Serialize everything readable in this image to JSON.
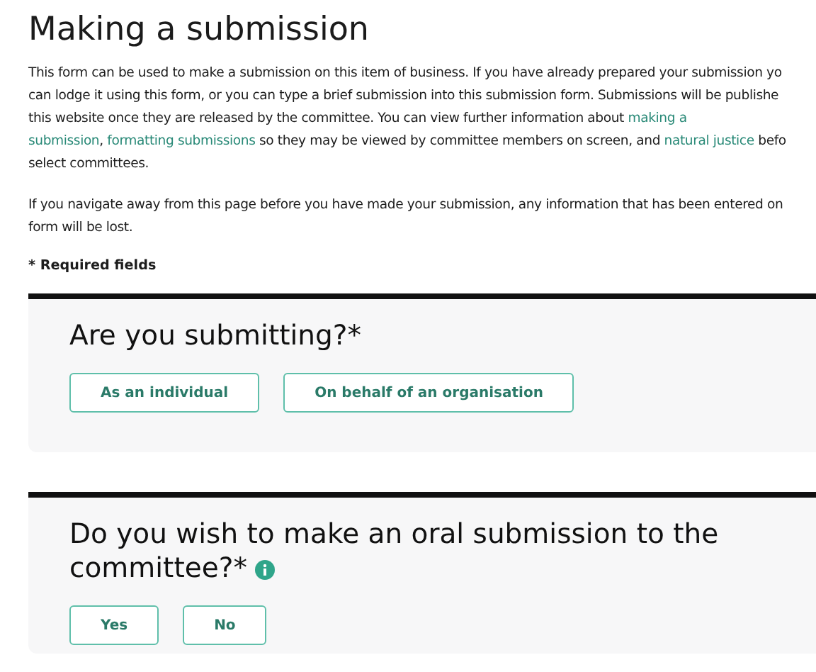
{
  "title": "Making a submission",
  "paragraphs": [
    [
      [
        {
          "text": "This form can be used to make a submission on this item of business. If you have already prepared your submission yo",
          "link": false
        }
      ],
      [
        {
          "text": "can lodge it using this form, or you can type a brief submission into this submission form. Submissions will be publishe",
          "link": false
        }
      ],
      [
        {
          "text": "this website once they are released by the committee. You can view further information about ",
          "link": false
        },
        {
          "text": "making a",
          "link": true
        }
      ],
      [
        {
          "text": "submission",
          "link": true
        },
        {
          "text": ", ",
          "link": false
        },
        {
          "text": "formatting submissions",
          "link": true
        },
        {
          "text": " so they may be viewed by committee members on screen, and ",
          "link": false
        },
        {
          "text": "natural justice",
          "link": true
        },
        {
          "text": " befo",
          "link": false
        }
      ],
      [
        {
          "text": "select committees.",
          "link": false
        }
      ]
    ],
    [
      [
        {
          "text": "If you navigate away from this page before you have made your submission, any information that has been entered on",
          "link": false
        }
      ],
      [
        {
          "text": "form will be lost.",
          "link": false
        }
      ]
    ]
  ],
  "required_note": "* Required fields",
  "questions": [
    {
      "question": "Are you submitting?*",
      "info": false,
      "options": [
        {
          "label": "As an individual",
          "selected": false
        },
        {
          "label": "On behalf of an organisation",
          "selected": false
        }
      ]
    },
    {
      "question": "Do you wish to make an oral submission to the committee?*",
      "info": true,
      "options": [
        {
          "label": "Yes",
          "selected": false
        },
        {
          "label": "No",
          "selected": false
        }
      ]
    }
  ]
}
